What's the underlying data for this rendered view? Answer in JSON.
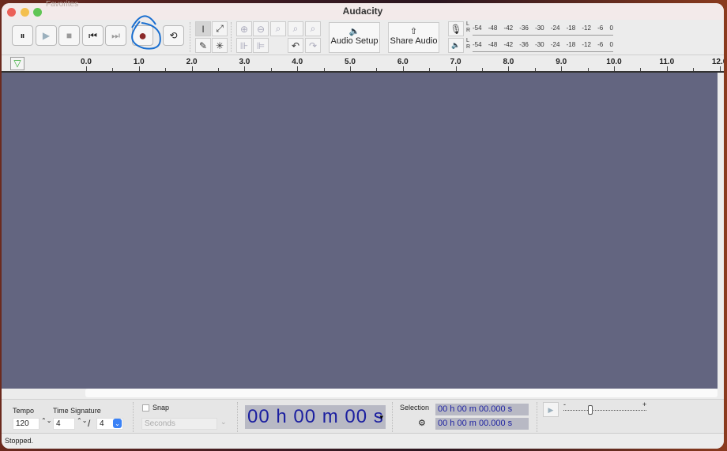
{
  "background_text": "Favorites",
  "window": {
    "title": "Audacity"
  },
  "transport": {
    "pause": "⏸",
    "play": "▶",
    "stop": "■",
    "skip_start": "⏮",
    "skip_end": "⏭",
    "record": "●",
    "loop": "⟲"
  },
  "tools": {
    "select": "I",
    "envelope": "⤢",
    "draw": "✎",
    "multi": "✳"
  },
  "edit": {
    "zoom_in": "⊕",
    "zoom_out": "⊖",
    "fit_sel": "⌕",
    "fit_proj": "⌕",
    "zoom_toggle": "⌕",
    "trim": "⊪",
    "silence": "⊫",
    "undo": "↶",
    "redo": "↷"
  },
  "audio_setup": {
    "icon": "🔈",
    "label": "Audio Setup"
  },
  "share_audio": {
    "icon": "⇧",
    "label": "Share Audio"
  },
  "meters": {
    "record_ticks": [
      "-54",
      "-48",
      "-42",
      "-36",
      "-30",
      "-24",
      "-18",
      "-12",
      "-6",
      "0"
    ],
    "play_ticks": [
      "-54",
      "-48",
      "-42",
      "-36",
      "-30",
      "-24",
      "-18",
      "-12",
      "-6",
      "0"
    ],
    "channels": [
      "L",
      "R"
    ]
  },
  "ruler": {
    "ticks": [
      "0.0",
      "1.0",
      "2.0",
      "3.0",
      "4.0",
      "5.0",
      "6.0",
      "7.0",
      "8.0",
      "9.0",
      "10.0",
      "11.0",
      "12.0"
    ]
  },
  "bottom": {
    "tempo_label": "Tempo",
    "tempo": "120",
    "time_sig_label": "Time Signature",
    "time_sig_num": "4",
    "time_sig_slash": "/",
    "time_sig_den": "4",
    "snap_label": "Snap",
    "snap_unit": "Seconds",
    "time_display": "00 h 00 m 00 s",
    "selection_label": "Selection",
    "sel_start": "00 h 00 m 00.000 s",
    "sel_end": "00 h 00 m 00.000 s",
    "speed_minus": "-",
    "speed_plus": "+"
  },
  "status": "Stopped.",
  "colors": {
    "track_bg": "#636580",
    "record": "#8b2a2a",
    "time_text": "#1b1fa0",
    "annotation": "#1a6fd0"
  }
}
